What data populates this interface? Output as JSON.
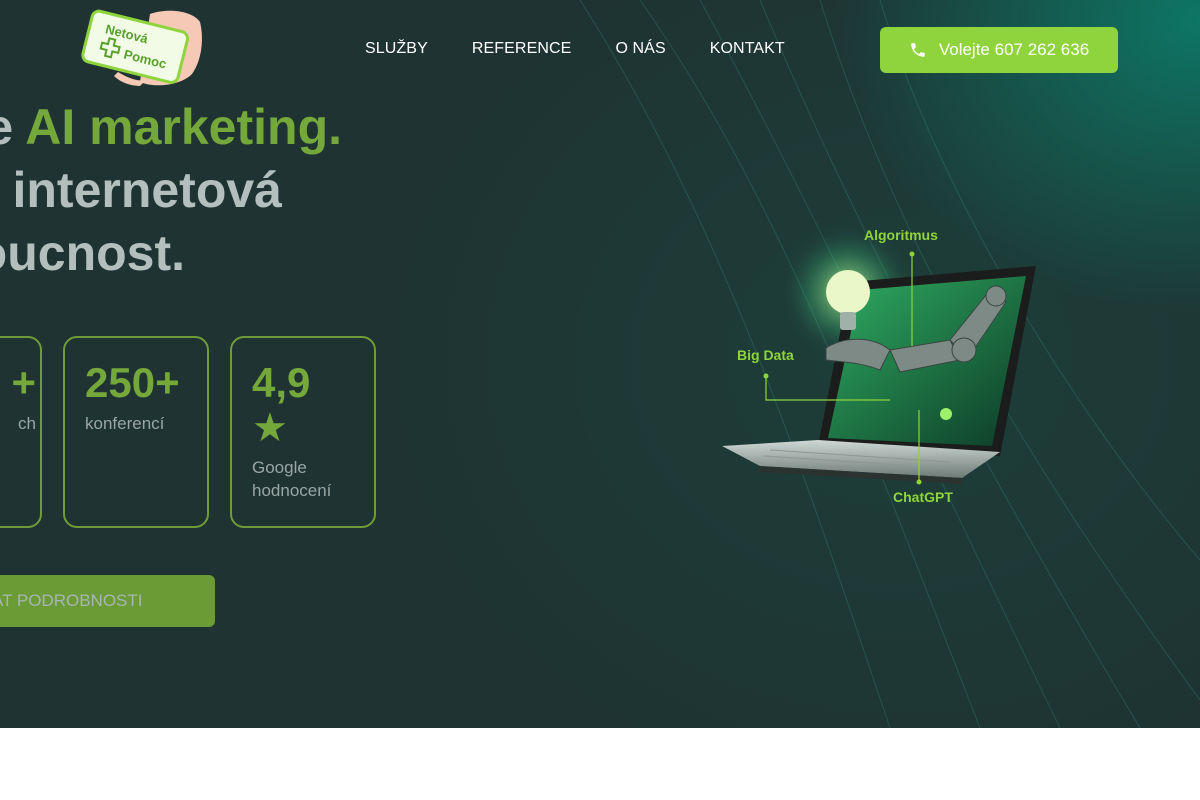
{
  "brand": {
    "logo_text_line1": "Netová",
    "logo_text_line2": "Pomoc",
    "accent_color": "#8fd43c",
    "dark_accent_color": "#6a9b34",
    "background_color": "#1e3332"
  },
  "nav": {
    "items": [
      {
        "label": "SLUŽBY"
      },
      {
        "label": "REFERENCE"
      },
      {
        "label": "O NÁS"
      },
      {
        "label": "KONTAKT"
      }
    ]
  },
  "call_button": {
    "label": "Volejte 607 262 636",
    "icon": "phone-icon"
  },
  "headline": {
    "line1_prefix": "e ",
    "line1_accent": "AI marketing.",
    "line2": " internetová",
    "line3": "oucnost."
  },
  "stats": [
    {
      "value": "+",
      "label": "ch"
    },
    {
      "value": "250+",
      "label": "konferencí"
    },
    {
      "value": "4,9",
      "icon": "star-icon",
      "label": "Google hodnocení"
    }
  ],
  "cta": {
    "label": "AT PODROBNOSTI"
  },
  "illustration": {
    "labels": {
      "algorithm": "Algoritmus",
      "big_data": "Big Data",
      "chatgpt": "ChatGPT"
    }
  }
}
